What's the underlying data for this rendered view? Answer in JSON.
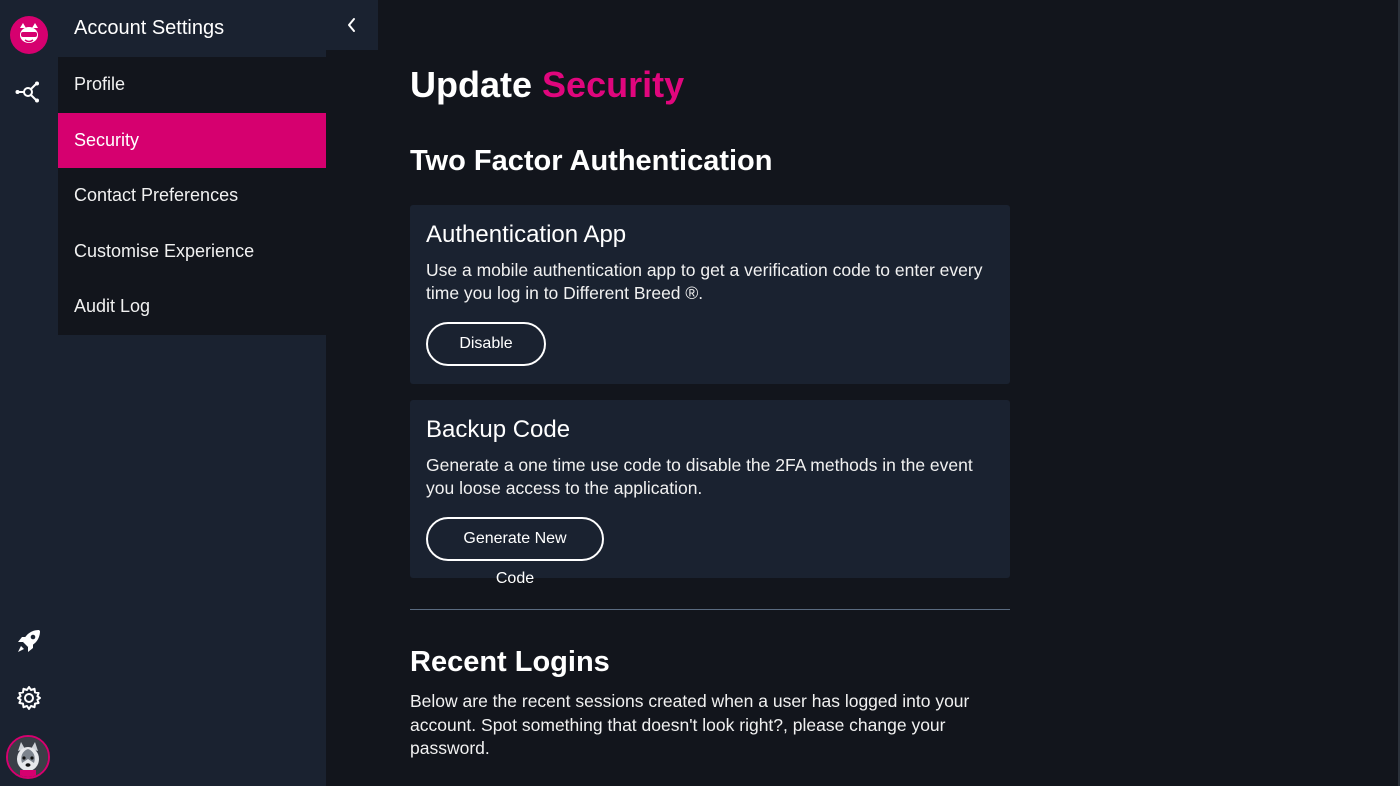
{
  "colors": {
    "accent": "#d6006f",
    "sidebar": "#1a2230",
    "background": "#12151c"
  },
  "icons": {
    "brand": "cat-mascot-logo",
    "network": "network-nodes-icon",
    "rocket": "rocket-icon",
    "settings": "gear-icon",
    "avatar": "husky-avatar",
    "collapse": "chevron-left-icon"
  },
  "sidebar": {
    "title": "Account Settings",
    "items": [
      {
        "label": "Profile",
        "active": false
      },
      {
        "label": "Security",
        "active": true
      },
      {
        "label": "Contact Preferences",
        "active": false
      },
      {
        "label": "Customise Experience",
        "active": false
      },
      {
        "label": "Audit Log",
        "active": false
      }
    ]
  },
  "page": {
    "title_prefix": "Update",
    "title_accent": "Security"
  },
  "two_factor": {
    "heading": "Two Factor Authentication",
    "auth_app": {
      "title": "Authentication App",
      "description": "Use a mobile authentication app to get a verification code to enter every time you log in to Different Breed ®.",
      "button": "Disable"
    },
    "backup_code": {
      "title": "Backup Code",
      "description": "Generate a one time use code to disable the 2FA methods in the event you loose access to the application.",
      "button": "Generate New Code"
    }
  },
  "recent_logins": {
    "heading": "Recent Logins",
    "description": "Below are the recent sessions created when a user has logged into your account. Spot something that doesn't look right?, please change your password."
  }
}
